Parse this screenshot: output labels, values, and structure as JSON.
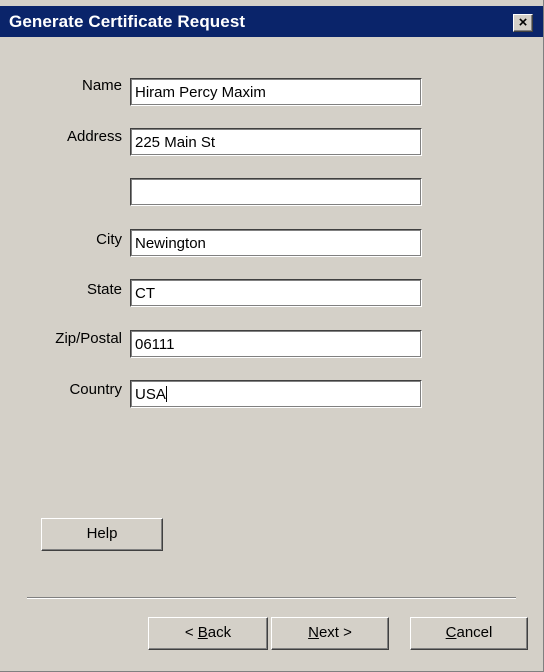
{
  "window": {
    "title": "Generate Certificate Request",
    "close_glyph": "×"
  },
  "form": {
    "name": {
      "label": "Name",
      "value": "Hiram Percy Maxim"
    },
    "address": {
      "label": "Address",
      "value": "225 Main St"
    },
    "address2": {
      "label": "",
      "value": ""
    },
    "city": {
      "label": "City",
      "value": "Newington"
    },
    "state": {
      "label": "State",
      "value": "CT"
    },
    "zip": {
      "label": "Zip/Postal",
      "value": "06111"
    },
    "country": {
      "label": "Country",
      "value": "USA"
    }
  },
  "buttons": {
    "help": "Help",
    "back": {
      "prefix": "< ",
      "accel": "B",
      "rest": "ack"
    },
    "next": {
      "accel": "N",
      "rest": "ext >"
    },
    "cancel": {
      "accel": "C",
      "rest": "ancel"
    }
  },
  "colors": {
    "titlebar": "#0a246a",
    "face": "#d4d0c8"
  }
}
